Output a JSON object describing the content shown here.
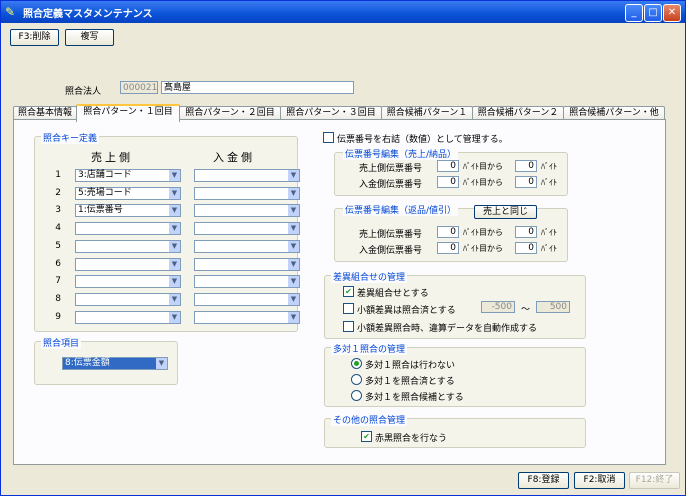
{
  "window": {
    "title": "照合定義マスタメンテナンス"
  },
  "toolbar": {
    "delete_label": "F3:削除",
    "copy_label": "複写"
  },
  "header": {
    "label": "照合法人",
    "code": "000021",
    "name": "髙島屋"
  },
  "tabs": [
    {
      "label": "照合基本情報"
    },
    {
      "label": "照合パターン・１回目"
    },
    {
      "label": "照合パターン・２回目"
    },
    {
      "label": "照合パターン・３回目"
    },
    {
      "label": "照合候補パターン１"
    },
    {
      "label": "照合候補パターン２"
    },
    {
      "label": "照合候補パターン・他"
    }
  ],
  "key_def": {
    "title": "照合キー定義",
    "col_sales": "売上側",
    "col_payment": "入金側",
    "rows": [
      {
        "no": "1",
        "sales": "3:店舗コード",
        "payment": ""
      },
      {
        "no": "2",
        "sales": "5:売場コード",
        "payment": ""
      },
      {
        "no": "3",
        "sales": "1:伝票番号",
        "payment": ""
      },
      {
        "no": "4",
        "sales": "",
        "payment": ""
      },
      {
        "no": "5",
        "sales": "",
        "payment": ""
      },
      {
        "no": "6",
        "sales": "",
        "payment": ""
      },
      {
        "no": "7",
        "sales": "",
        "payment": ""
      },
      {
        "no": "8",
        "sales": "",
        "payment": ""
      },
      {
        "no": "9",
        "sales": "",
        "payment": ""
      }
    ]
  },
  "match_item": {
    "title": "照合項目",
    "value": "8:伝票金額"
  },
  "slip": {
    "right_align_label": "伝票番号を右詰（数値）として管理する。",
    "sales_edit": {
      "title": "伝票番号編集（売上/納品）",
      "rows": [
        {
          "label": "売上側伝票番号",
          "from": "0",
          "from_unit": "ﾊﾞｲﾄ目から",
          "len": "0",
          "len_unit": "ﾊﾞｲﾄ"
        },
        {
          "label": "入金側伝票番号",
          "from": "0",
          "from_unit": "ﾊﾞｲﾄ目から",
          "len": "0",
          "len_unit": "ﾊﾞｲﾄ"
        }
      ]
    },
    "return_edit": {
      "title": "伝票番号編集（返品/値引）",
      "same_button": "売上と同じ",
      "rows": [
        {
          "label": "売上側伝票番号",
          "from": "0",
          "from_unit": "ﾊﾞｲﾄ目から",
          "len": "0",
          "len_unit": "ﾊﾞｲﾄ"
        },
        {
          "label": "入金側伝票番号",
          "from": "0",
          "from_unit": "ﾊﾞｲﾄ目から",
          "len": "0",
          "len_unit": "ﾊﾞｲﾄ"
        }
      ]
    }
  },
  "diff": {
    "title": "差異組合せの管理",
    "opt1": "差異組合せとする",
    "opt2": "小額差異は照合済とする",
    "min": "-500",
    "tilde": "～",
    "max": "500",
    "opt3": "小額差異照合時、違算データを自動作成する"
  },
  "many": {
    "title": "多対１照合の管理",
    "opt1": "多対１照合は行わない",
    "opt2": "多対１を照合済とする",
    "opt3": "多対１を照合候補とする"
  },
  "other": {
    "title": "その他の照合管理",
    "opt1": "赤黒照合を行なう"
  },
  "footer": {
    "register": "F8:登録",
    "cancel": "F2:取消",
    "exit": "F12:終了"
  },
  "colors": {
    "title_blue": "#0a52d8",
    "group_title": "#0046d5",
    "check_green": "#21a121"
  }
}
